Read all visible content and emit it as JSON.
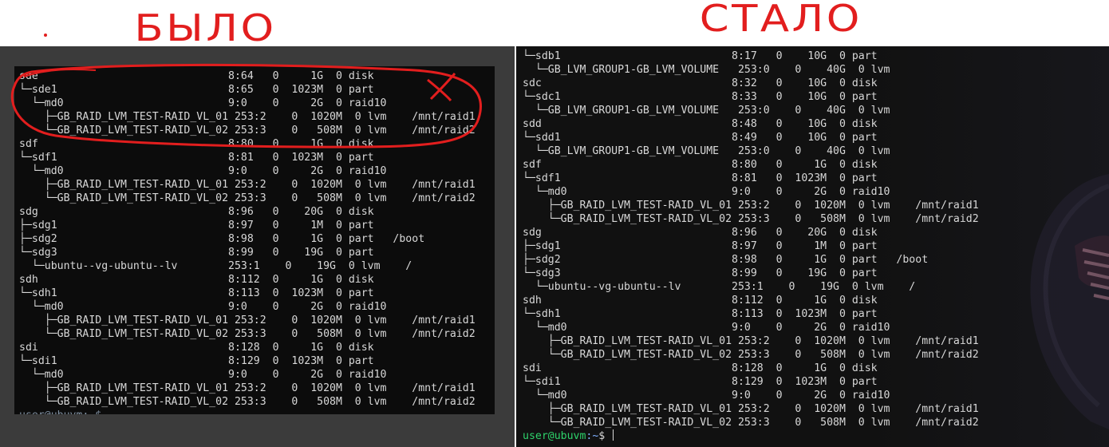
{
  "annotations": {
    "before_label": "БЫЛО",
    "after_label": "СТАЛО"
  },
  "left_terminal": {
    "lines": [
      "sde                              8:64   0     1G  0 disk",
      "└─sde1                           8:65   0  1023M  0 part",
      "  └─md0                          9:0    0     2G  0 raid10",
      "    ├─GB_RAID_LVM_TEST-RAID_VL_01 253:2    0  1020M  0 lvm    /mnt/raid1",
      "    └─GB_RAID_LVM_TEST-RAID_VL_02 253:3    0   508M  0 lvm    /mnt/raid2",
      "sdf                              8:80   0     1G  0 disk",
      "└─sdf1                           8:81   0  1023M  0 part",
      "  └─md0                          9:0    0     2G  0 raid10",
      "    ├─GB_RAID_LVM_TEST-RAID_VL_01 253:2    0  1020M  0 lvm    /mnt/raid1",
      "    └─GB_RAID_LVM_TEST-RAID_VL_02 253:3    0   508M  0 lvm    /mnt/raid2",
      "sdg                              8:96   0    20G  0 disk",
      "├─sdg1                           8:97   0     1M  0 part",
      "├─sdg2                           8:98   0     1G  0 part   /boot",
      "└─sdg3                           8:99   0    19G  0 part",
      "  └─ubuntu--vg-ubuntu--lv        253:1    0    19G  0 lvm    /",
      "sdh                              8:112  0     1G  0 disk",
      "└─sdh1                           8:113  0  1023M  0 part",
      "  └─md0                          9:0    0     2G  0 raid10",
      "    ├─GB_RAID_LVM_TEST-RAID_VL_01 253:2    0  1020M  0 lvm    /mnt/raid1",
      "    └─GB_RAID_LVM_TEST-RAID_VL_02 253:3    0   508M  0 lvm    /mnt/raid2",
      "sdi                              8:128  0     1G  0 disk",
      "└─sdi1                           8:129  0  1023M  0 part",
      "  └─md0                          9:0    0     2G  0 raid10",
      "    ├─GB_RAID_LVM_TEST-RAID_VL_01 253:2    0  1020M  0 lvm    /mnt/raid1",
      "    └─GB_RAID_LVM_TEST-RAID_VL_02 253:3    0   508M  0 lvm    /mnt/raid2"
    ],
    "prompt": "user@ubuvm:~$"
  },
  "right_terminal": {
    "lines": [
      "└─sdb1                           8:17   0    10G  0 part",
      "  └─GB_LVM_GROUP1-GB_LVM_VOLUME   253:0    0    40G  0 lvm",
      "sdc                              8:32   0    10G  0 disk",
      "└─sdc1                           8:33   0    10G  0 part",
      "  └─GB_LVM_GROUP1-GB_LVM_VOLUME   253:0    0    40G  0 lvm",
      "sdd                              8:48   0    10G  0 disk",
      "└─sdd1                           8:49   0    10G  0 part",
      "  └─GB_LVM_GROUP1-GB_LVM_VOLUME   253:0    0    40G  0 lvm",
      "sdf                              8:80   0     1G  0 disk",
      "└─sdf1                           8:81   0  1023M  0 part",
      "  └─md0                          9:0    0     2G  0 raid10",
      "    ├─GB_RAID_LVM_TEST-RAID_VL_01 253:2    0  1020M  0 lvm    /mnt/raid1",
      "    └─GB_RAID_LVM_TEST-RAID_VL_02 253:3    0   508M  0 lvm    /mnt/raid2",
      "sdg                              8:96   0    20G  0 disk",
      "├─sdg1                           8:97   0     1M  0 part",
      "├─sdg2                           8:98   0     1G  0 part   /boot",
      "└─sdg3                           8:99   0    19G  0 part",
      "  └─ubuntu--vg-ubuntu--lv        253:1    0    19G  0 lvm    /",
      "sdh                              8:112  0     1G  0 disk",
      "└─sdh1                           8:113  0  1023M  0 part",
      "  └─md0                          9:0    0     2G  0 raid10",
      "    ├─GB_RAID_LVM_TEST-RAID_VL_01 253:2    0  1020M  0 lvm    /mnt/raid1",
      "    └─GB_RAID_LVM_TEST-RAID_VL_02 253:3    0   508M  0 lvm    /mnt/raid2",
      "sdi                              8:128  0     1G  0 disk",
      "└─sdi1                           8:129  0  1023M  0 part",
      "  └─md0                          9:0    0     2G  0 raid10",
      "    ├─GB_RAID_LVM_TEST-RAID_VL_01 253:2    0  1020M  0 lvm    /mnt/raid1",
      "    └─GB_RAID_LVM_TEST-RAID_VL_02 253:3    0   508M  0 lvm    /mnt/raid2"
    ],
    "prompt_user": "user@ubuvm",
    "prompt_path": ":~",
    "prompt_symbol": "$"
  },
  "colors": {
    "annotation_red": "#e21e1e",
    "prompt_green": "#2ed36b",
    "prompt_blue": "#7fb0ff",
    "terminal_text": "#d8d8d8"
  },
  "icons": {
    "strike_mark": "x-mark-icon"
  }
}
